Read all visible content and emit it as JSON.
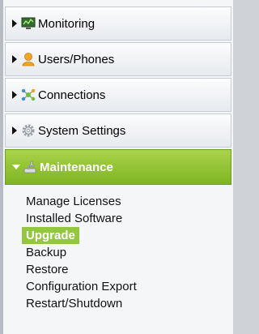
{
  "nav": {
    "sections": [
      {
        "label": "Monitoring",
        "icon": "monitor-icon",
        "expanded": false
      },
      {
        "label": "Users/Phones",
        "icon": "user-icon",
        "expanded": false
      },
      {
        "label": "Connections",
        "icon": "connections-icon",
        "expanded": false
      },
      {
        "label": "System Settings",
        "icon": "gear-icon",
        "expanded": false
      },
      {
        "label": "Maintenance",
        "icon": "wrench-icon",
        "expanded": true
      }
    ],
    "maintenance_items": [
      "Manage Licenses",
      "Installed Software",
      "Upgrade",
      "Backup",
      "Restore",
      "Configuration Export",
      "Restart/Shutdown"
    ],
    "selected_item": "Upgrade"
  },
  "colors": {
    "active_section": "#8dc13a",
    "selected_item": "#94c740"
  }
}
